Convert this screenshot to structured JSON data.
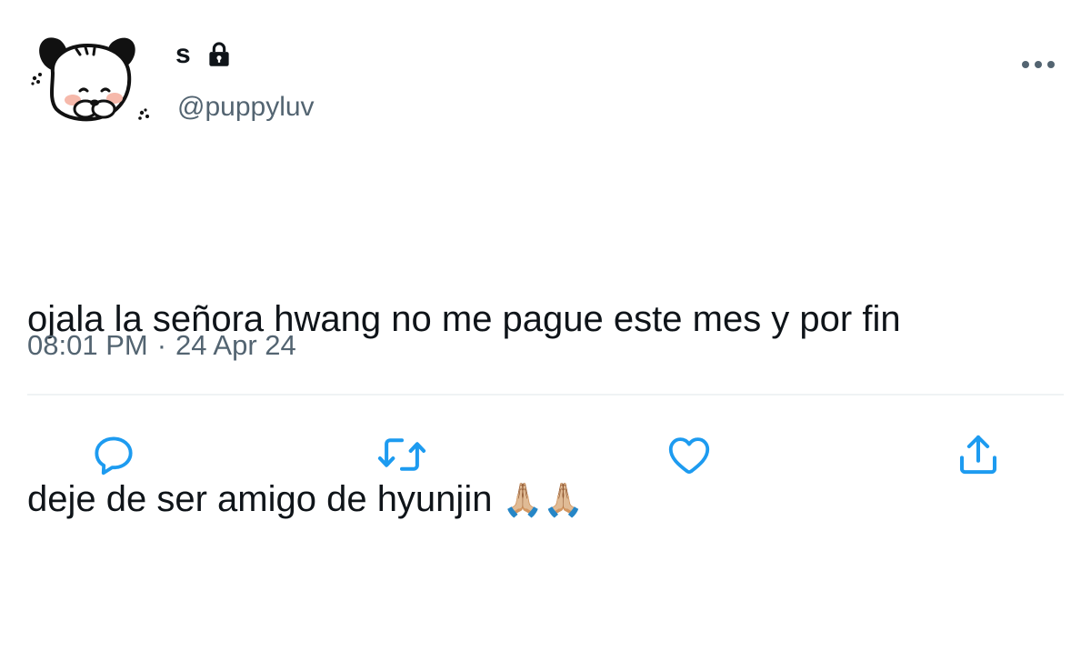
{
  "user": {
    "display_name": "s",
    "handle": "@puppyluv",
    "avatar_icon": "pochacco-avatar-icon",
    "protected_icon": "lock-icon"
  },
  "tweet": {
    "text_line1": "ojala la señora hwang no me pague este mes y por fin",
    "text_line2": "deje de ser amigo de hyunjin",
    "emoji": "🙏🏼🙏🏼",
    "time": "08:01 PM",
    "separator": "·",
    "date": "24 Apr 24"
  },
  "actions": {
    "reply_icon": "reply-icon",
    "retweet_icon": "retweet-icon",
    "like_icon": "heart-icon",
    "share_icon": "share-icon",
    "more_icon": "more-icon"
  },
  "colors": {
    "text": "#0f1419",
    "secondary": "#536471",
    "icon_blue": "#1d9bf0",
    "divider": "#eff3f4"
  }
}
